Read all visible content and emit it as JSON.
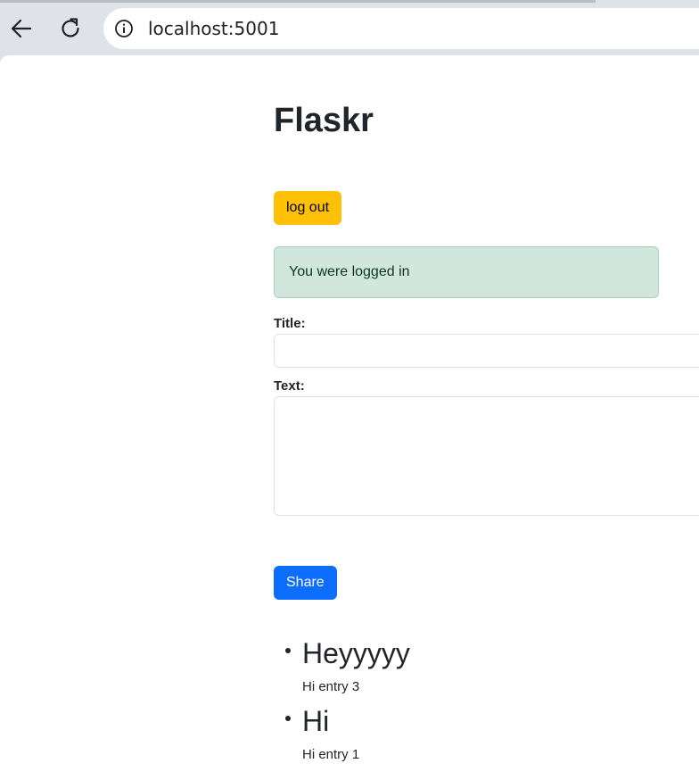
{
  "browser": {
    "url": "localhost:5001"
  },
  "page": {
    "title": "Flaskr",
    "logout_label": "log out",
    "flash_message": "You were logged in",
    "form": {
      "title_label": "Title:",
      "text_label": "Text:",
      "title_value": "",
      "text_value": "",
      "share_label": "Share"
    },
    "entries": [
      {
        "title": "Heyyyyy",
        "text": "Hi entry 3"
      },
      {
        "title": "Hi",
        "text": "Hi entry 1"
      }
    ]
  },
  "colors": {
    "logout_button": "#ffc107",
    "share_button": "#0d6efd",
    "flash_background": "#d1e7dd",
    "flash_border": "#a3cfbb"
  },
  "icons": {
    "back": "back-arrow-icon",
    "reload": "reload-icon",
    "info": "info-icon"
  }
}
